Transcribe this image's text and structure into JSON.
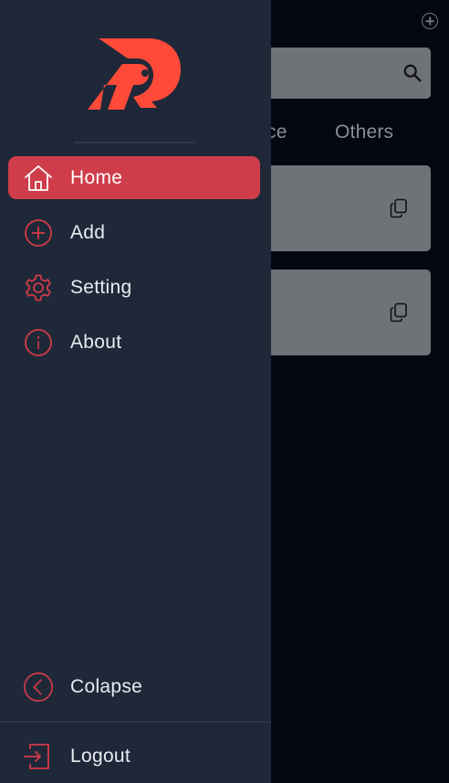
{
  "background": {
    "search_icon": "search-icon",
    "tabs": [
      {
        "label": "ce"
      },
      {
        "label": "Others"
      }
    ],
    "cards": [
      {
        "icon": "copy-icon"
      },
      {
        "icon": "copy-icon"
      }
    ]
  },
  "drawer": {
    "logo": "brand-logo",
    "items": [
      {
        "label": "Home",
        "icon": "home-icon",
        "active": true
      },
      {
        "label": "Add",
        "icon": "plus-circle-icon",
        "active": false
      },
      {
        "label": "Setting",
        "icon": "gear-icon",
        "active": false
      },
      {
        "label": "About",
        "icon": "info-icon",
        "active": false
      }
    ],
    "collapse": {
      "label": "Colapse",
      "icon": "chevron-left-circle-icon"
    },
    "logout": {
      "label": "Logout",
      "icon": "logout-icon"
    }
  },
  "colors": {
    "accent": "#cf3d4b",
    "drawer_bg": "#1f2838",
    "icon_red": "#d23a48",
    "logo_red": "#ff4a3a",
    "app_bg": "#020711"
  }
}
